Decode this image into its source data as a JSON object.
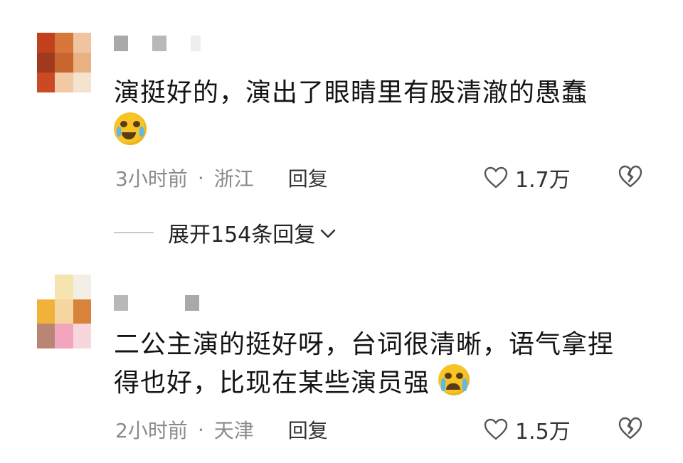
{
  "comments": [
    {
      "text": "演挺好的，演出了眼睛里有股清澈的愚蠢",
      "emoji": "laughing-tears-emoji",
      "time": "3小时前",
      "location": "浙江",
      "reply_label": "回复",
      "likes": "1.7万",
      "avatar_colors": [
        "#c2411d",
        "#d8773c",
        "#f0c4a0",
        "#a03a1f",
        "#c9652e",
        "#e9b182",
        "#c94a24",
        "#f1c9a5",
        "#f6e3cf"
      ]
    },
    {
      "text": "二公主演的挺好呀，台词很清晰，语气拿捏得也好，比现在某些演员强",
      "emoji": "crying-emoji",
      "time": "2小时前",
      "location": "天津",
      "reply_label": "回复",
      "likes": "1.5万",
      "avatar_colors": [
        "#ffffff",
        "#f5e3b0",
        "#f3efe6",
        "#f2b23a",
        "#f5d6a0",
        "#d9833a",
        "#b98676",
        "#f2a6bd",
        "#f7d7dc"
      ]
    }
  ],
  "expand_replies": {
    "label": "展开154条回复"
  },
  "colors": {
    "text": "#141414",
    "meta": "#8a8a8a",
    "name_block": "#b5b5b5"
  }
}
